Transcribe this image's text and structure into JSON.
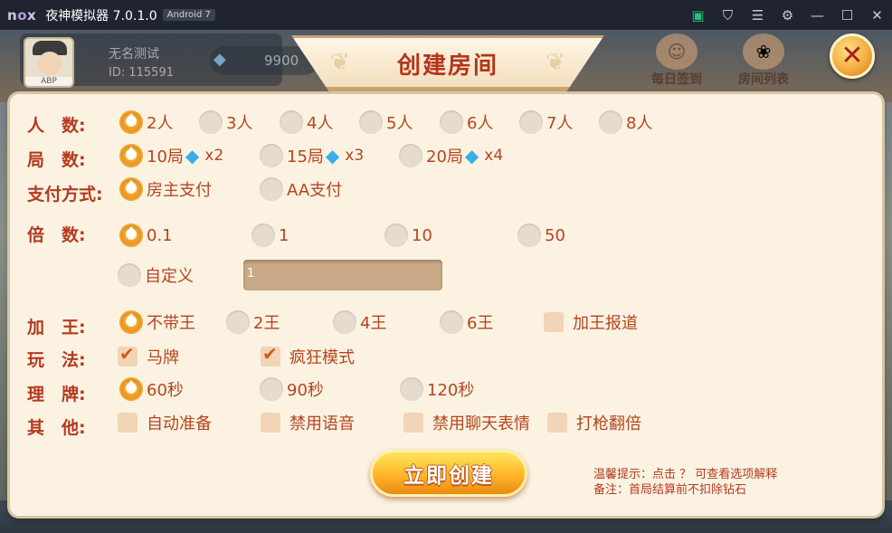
{
  "emulator": {
    "logo_prefix": "n",
    "logo_o": "o",
    "logo_suffix": "x",
    "title": "夜神模拟器 7.0.1.0",
    "android_badge": "Android 7"
  },
  "player": {
    "avatar_tag": "ABP",
    "name": "无名测试",
    "id": "ID: 115591",
    "diamonds": "9900"
  },
  "top_buttons": {
    "daily_checkin": "每日签到",
    "room_list": "房间列表"
  },
  "dialog": {
    "title": "创建房间",
    "close_glyph": "✕"
  },
  "rows": {
    "players": {
      "label": "人　数:",
      "options": [
        "2人",
        "3人",
        "4人",
        "5人",
        "6人",
        "7人",
        "8人"
      ],
      "selected": 0
    },
    "rounds": {
      "label": "局　数:",
      "options": [
        {
          "text": "10局",
          "mult": "x2"
        },
        {
          "text": "15局",
          "mult": "x3"
        },
        {
          "text": "20局",
          "mult": "x4"
        }
      ],
      "selected": 0
    },
    "payment": {
      "label": "支付方式:",
      "options": [
        "房主支付",
        "AA支付"
      ],
      "selected": 0
    },
    "multiplier": {
      "label": "倍　数:",
      "options": [
        "0.1",
        "1",
        "10",
        "50"
      ],
      "selected": 0,
      "custom_label": "自定义",
      "custom_value": "1"
    },
    "jokers": {
      "label": "加　王:",
      "options": [
        "不带王",
        "2王",
        "4王",
        "6王"
      ],
      "selected": 0,
      "checkbox_label": "加王报道",
      "checkbox_checked": false
    },
    "play_mode": {
      "label": "玩　法:",
      "options": [
        "马牌",
        "疯狂模式"
      ],
      "checked": [
        true,
        true
      ]
    },
    "arrange": {
      "label": "理　牌:",
      "options": [
        "60秒",
        "90秒",
        "120秒"
      ],
      "selected": 0
    },
    "other": {
      "label": "其　他:",
      "options": [
        "自动准备",
        "禁用语音",
        "禁用聊天表情",
        "打枪翻倍"
      ],
      "checked": [
        false,
        false,
        false,
        false
      ]
    }
  },
  "create_button": "立即创建",
  "tips": {
    "line1": "温馨提示：点击 ？ 可查看选项解释",
    "line2": "备注：首局结算前不扣除钻石"
  },
  "icons": {
    "selected_radio": "spade-icon",
    "diamond": "diamond-icon",
    "check": "check-icon"
  },
  "colors": {
    "label_red": "#b33a1f",
    "dialog_bg": "#fbf2e2",
    "accent_orange": "#f0a530"
  }
}
